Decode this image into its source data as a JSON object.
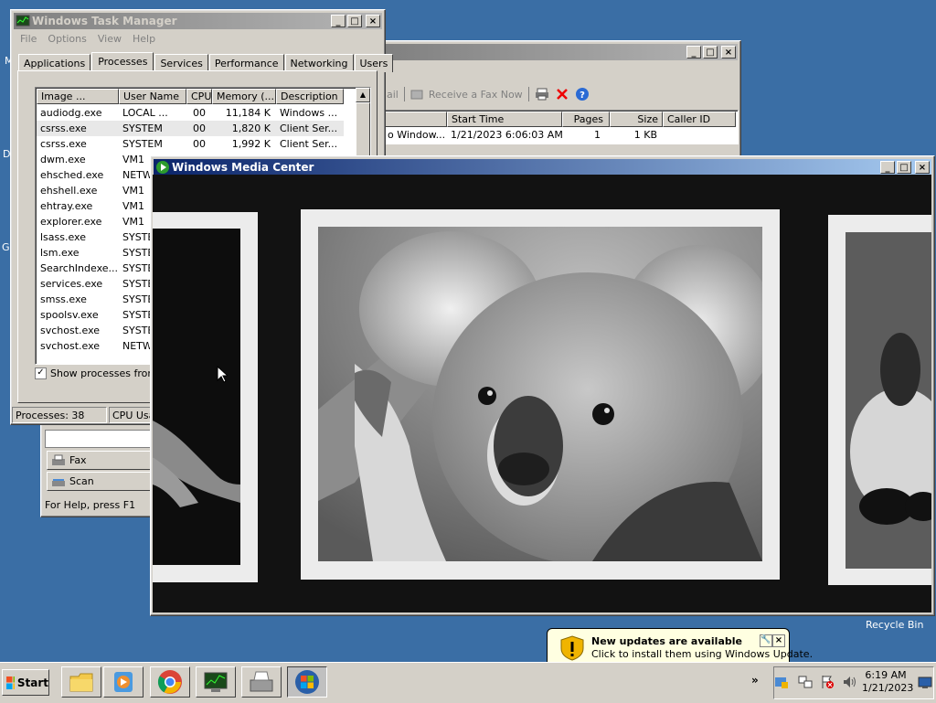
{
  "desktop": {
    "recycle_bin_label": "Recycle Bin",
    "left_edge_letters": [
      "M",
      "D",
      "G"
    ]
  },
  "fax_window": {
    "title": "",
    "toolbar": {
      "mail_fragment": "ail",
      "receive_label": "Receive a Fax Now"
    },
    "columns": [
      "Start Time",
      "Pages",
      "Size",
      "Caller ID"
    ],
    "first_col_fragment": "o Window...",
    "row": {
      "start_time": "1/21/2023 6:06:03 AM",
      "pages": "1",
      "size": "1 KB",
      "caller_id": ""
    },
    "sidebar": {
      "fax": "Fax",
      "scan": "Scan"
    },
    "status": "For Help, press F1"
  },
  "task_manager": {
    "title": "Windows Task Manager",
    "menu": [
      "File",
      "Options",
      "View",
      "Help"
    ],
    "tabs": [
      "Applications",
      "Processes",
      "Services",
      "Performance",
      "Networking",
      "Users"
    ],
    "selected_tab": "Processes",
    "columns": [
      "Image ...",
      "User Name",
      "CPU",
      "Memory (...",
      "Description"
    ],
    "rows": [
      [
        "audiodg.exe",
        "LOCAL ...",
        "00",
        "11,184 K",
        "Windows ..."
      ],
      [
        "csrss.exe",
        "SYSTEM",
        "00",
        "1,820 K",
        "Client Ser..."
      ],
      [
        "csrss.exe",
        "SYSTEM",
        "00",
        "1,992 K",
        "Client Ser..."
      ],
      [
        "dwm.exe",
        "VM1",
        "",
        "",
        ""
      ],
      [
        "ehsched.exe",
        "NETW",
        "",
        "",
        ""
      ],
      [
        "ehshell.exe",
        "VM1",
        "",
        "",
        ""
      ],
      [
        "ehtray.exe",
        "VM1",
        "",
        "",
        ""
      ],
      [
        "explorer.exe",
        "VM1",
        "",
        "",
        ""
      ],
      [
        "lsass.exe",
        "SYSTE",
        "",
        "",
        ""
      ],
      [
        "lsm.exe",
        "SYSTE",
        "",
        "",
        ""
      ],
      [
        "SearchIndexe...",
        "SYSTE",
        "",
        "",
        ""
      ],
      [
        "services.exe",
        "SYSTE",
        "",
        "",
        ""
      ],
      [
        "smss.exe",
        "SYSTE",
        "",
        "",
        ""
      ],
      [
        "spoolsv.exe",
        "SYSTE",
        "",
        "",
        ""
      ],
      [
        "svchost.exe",
        "SYSTE",
        "",
        "",
        ""
      ],
      [
        "svchost.exe",
        "NETW",
        "",
        "",
        ""
      ]
    ],
    "show_all_label": "Show processes from a",
    "status_processes": "Processes: 38",
    "status_cpu": "CPU Usa"
  },
  "media_center": {
    "title": "Windows Media Center"
  },
  "notification": {
    "title": "New updates are available",
    "body": "Click to install them using Windows Update."
  },
  "taskbar": {
    "start_label": "Start",
    "clock_time": "6:19 AM",
    "clock_date": "1/21/2023",
    "tray_expand": "»"
  },
  "colors": {
    "desktop": "#3a6ea5",
    "titlebar_active": "#0a246a",
    "face": "#d4d0c8"
  }
}
